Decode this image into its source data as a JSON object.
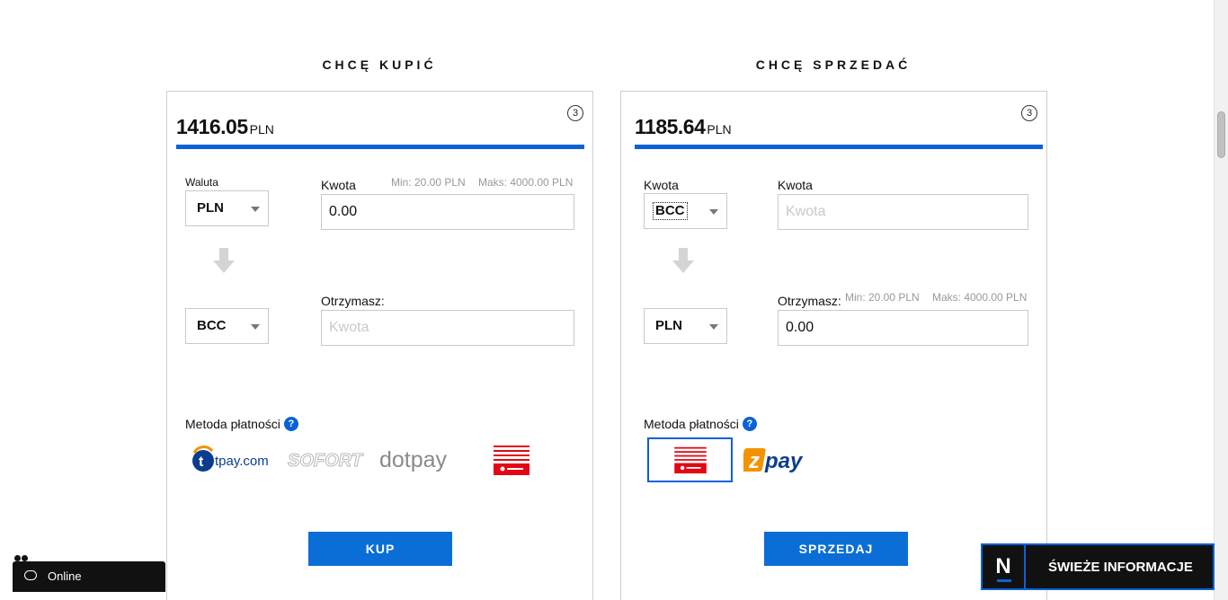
{
  "buy": {
    "title": "CHCĘ KUPIĆ",
    "price": "1416.05",
    "price_unit": "PLN",
    "info_badge": "3",
    "currency_label": "Waluta",
    "amount_label": "Kwota",
    "min_hint": "Min: 20.00 PLN",
    "max_hint": "Maks: 4000.00 PLN",
    "from_currency": "PLN",
    "amount_value": "0.00",
    "to_currency": "BCC",
    "receive_label": "Otrzymasz:",
    "receive_placeholder": "Kwota",
    "payment_label": "Metoda płatności",
    "payment_methods": [
      "tpay.com",
      "SOFORT",
      "dotpay",
      "Poczta Polska"
    ],
    "button_label": "KUP"
  },
  "sell": {
    "title": "CHCĘ SPRZEDAĆ",
    "price": "1185.64",
    "price_unit": "PLN",
    "info_badge": "3",
    "amount_label_left": "Kwota",
    "amount_label": "Kwota",
    "from_currency": "BCC",
    "amount_placeholder": "Kwota",
    "receive_label": "Otrzymasz:",
    "min_hint": "Min: 20.00 PLN",
    "max_hint": "Maks: 4000.00 PLN",
    "to_currency": "PLN",
    "receive_value": "0.00",
    "payment_label": "Metoda płatności",
    "payment_methods": [
      "Poczta Polska",
      "zpay"
    ],
    "button_label": "SPRZEDAJ"
  },
  "chat": {
    "status_label": "Online"
  },
  "news": {
    "logo_letter": "N",
    "label": "ŚWIEŻE INFORMACJE"
  },
  "colors": {
    "accent": "#0a62d6",
    "button": "#0a6ed6",
    "tpay_orange": "#f39200",
    "poczta_red": "#e30613"
  },
  "help_icon": "?"
}
